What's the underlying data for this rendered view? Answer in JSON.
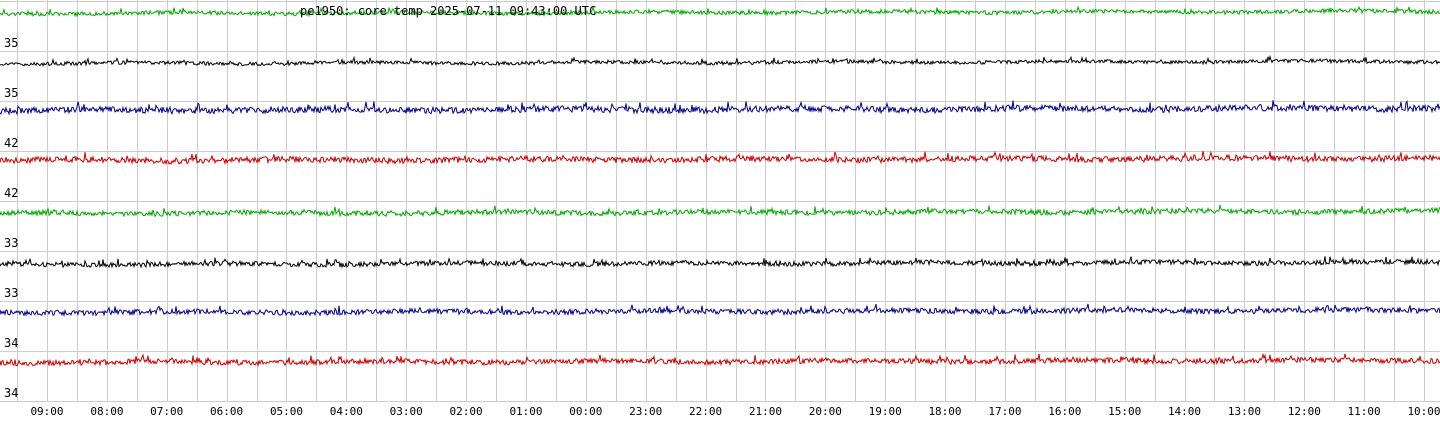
{
  "chart_data": {
    "type": "line",
    "title": "pe1950: core temp 2025-07-11 09:43:00 UTC",
    "xlabel": "",
    "ylabel": "",
    "grid": true,
    "x_tick_labels": [
      "09:00",
      "08:00",
      "07:00",
      "06:00",
      "05:00",
      "04:00",
      "03:00",
      "02:00",
      "01:00",
      "00:00",
      "23:00",
      "22:00",
      "21:00",
      "20:00",
      "19:00",
      "18:00",
      "17:00",
      "16:00",
      "15:00",
      "14:00",
      "13:00",
      "12:00",
      "11:00",
      "10:00"
    ],
    "series": [
      {
        "label": "35",
        "color": "#00aa00",
        "level": 35
      },
      {
        "label": "35",
        "color": "#000000",
        "level": 35
      },
      {
        "label": "42",
        "color": "#00008b",
        "level": 42
      },
      {
        "label": "42",
        "color": "#cc0000",
        "level": 42
      },
      {
        "label": "33",
        "color": "#00aa00",
        "level": 33
      },
      {
        "label": "33",
        "color": "#000000",
        "level": 33
      },
      {
        "label": "34",
        "color": "#00008b",
        "level": 34
      },
      {
        "label": "34",
        "color": "#cc0000",
        "level": 34
      }
    ],
    "colors": {
      "grid": "#cccccc",
      "background": "#ffffff",
      "text": "#000000"
    }
  }
}
